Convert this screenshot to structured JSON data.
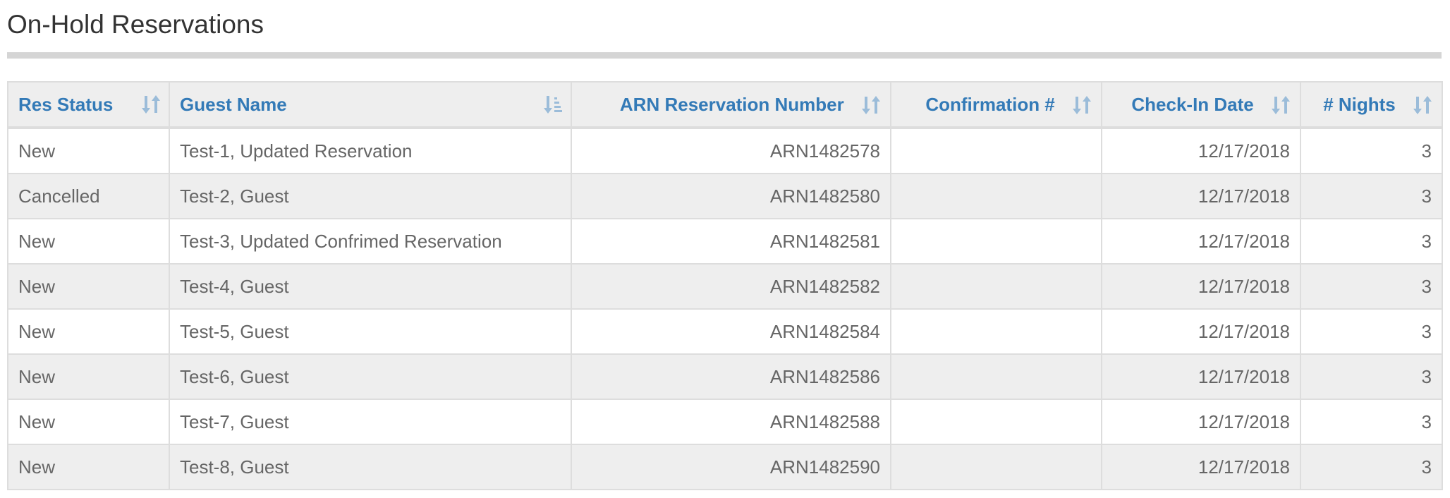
{
  "page": {
    "title": "On-Hold Reservations"
  },
  "table": {
    "columns": [
      {
        "key": "res_status",
        "label": "Res Status",
        "align": "left",
        "sort_icon": "sort-both-icon"
      },
      {
        "key": "guest_name",
        "label": "Guest Name",
        "align": "left",
        "sort_icon": "sort-ascending-active-icon"
      },
      {
        "key": "arn",
        "label": "ARN Reservation Number",
        "align": "right",
        "sort_icon": "sort-both-icon"
      },
      {
        "key": "confirmation",
        "label": "Confirmation #",
        "align": "right",
        "sort_icon": "sort-both-icon"
      },
      {
        "key": "checkin",
        "label": "Check-In Date",
        "align": "right",
        "sort_icon": "sort-both-icon"
      },
      {
        "key": "nights",
        "label": "# Nights",
        "align": "right",
        "sort_icon": "sort-both-icon"
      }
    ],
    "rows": [
      {
        "res_status": "New",
        "guest_name": "Test-1, Updated Reservation",
        "arn": "ARN1482578",
        "confirmation": "",
        "checkin": "12/17/2018",
        "nights": "3"
      },
      {
        "res_status": "Cancelled",
        "guest_name": "Test-2, Guest",
        "arn": "ARN1482580",
        "confirmation": "",
        "checkin": "12/17/2018",
        "nights": "3"
      },
      {
        "res_status": "New",
        "guest_name": "Test-3, Updated Confrimed Reservation",
        "arn": "ARN1482581",
        "confirmation": "",
        "checkin": "12/17/2018",
        "nights": "3"
      },
      {
        "res_status": "New",
        "guest_name": "Test-4, Guest",
        "arn": "ARN1482582",
        "confirmation": "",
        "checkin": "12/17/2018",
        "nights": "3"
      },
      {
        "res_status": "New",
        "guest_name": "Test-5, Guest",
        "arn": "ARN1482584",
        "confirmation": "",
        "checkin": "12/17/2018",
        "nights": "3"
      },
      {
        "res_status": "New",
        "guest_name": "Test-6, Guest",
        "arn": "ARN1482586",
        "confirmation": "",
        "checkin": "12/17/2018",
        "nights": "3"
      },
      {
        "res_status": "New",
        "guest_name": "Test-7, Guest",
        "arn": "ARN1482588",
        "confirmation": "",
        "checkin": "12/17/2018",
        "nights": "3"
      },
      {
        "res_status": "New",
        "guest_name": "Test-8, Guest",
        "arn": "ARN1482590",
        "confirmation": "",
        "checkin": "12/17/2018",
        "nights": "3"
      }
    ]
  },
  "colors": {
    "header_text": "#337ab7",
    "sort_icon": "#9bbcd9",
    "row_stripe": "#eeeeee",
    "border": "#dddddd",
    "cell_text": "#666666",
    "title_rule": "#d5d5d5"
  }
}
